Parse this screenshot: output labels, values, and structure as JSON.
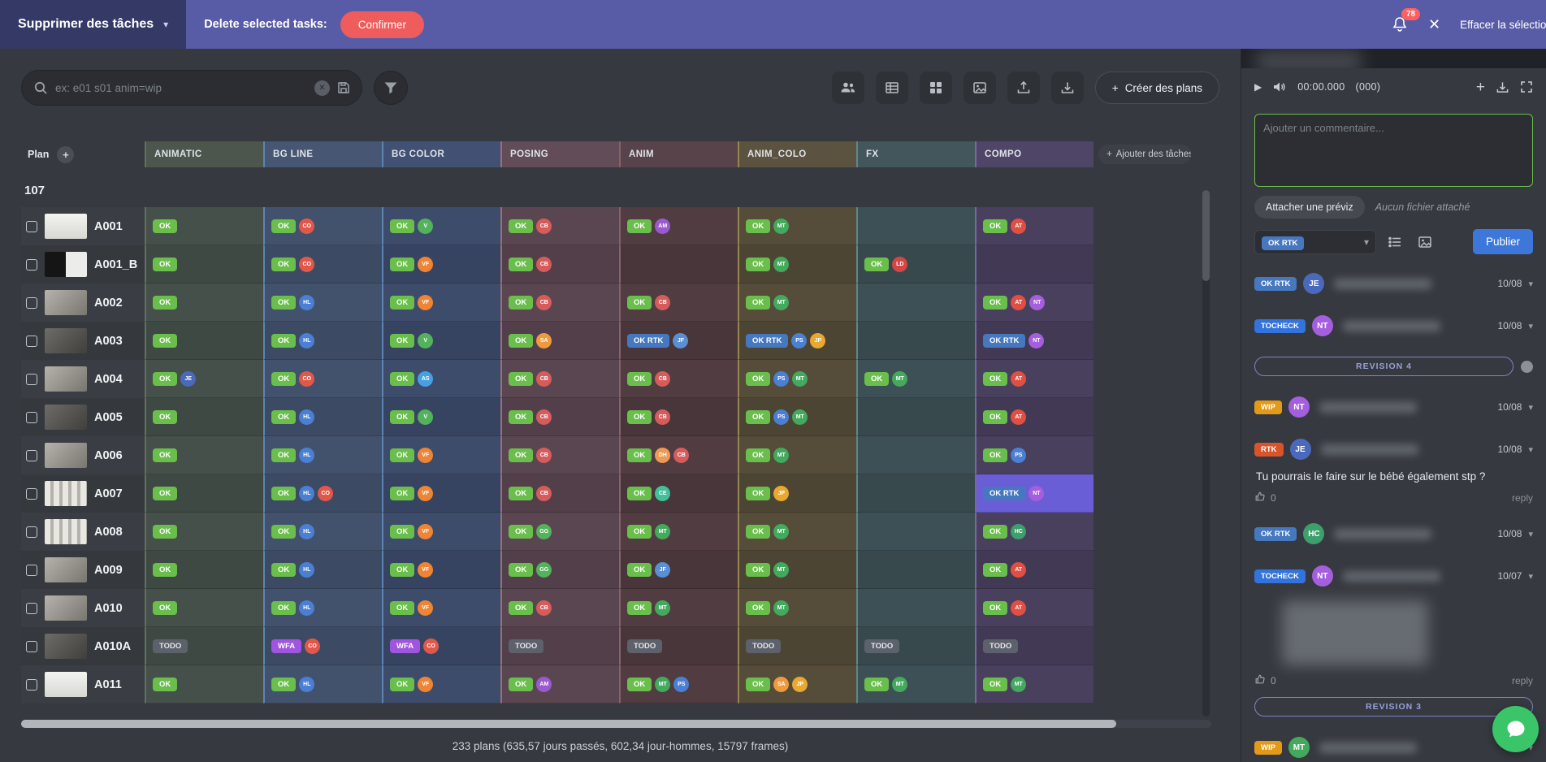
{
  "icons": {
    "chevron_down": "▾",
    "close": "✕",
    "plus": "+",
    "play": "▶"
  },
  "colors": {
    "selection": "#6a5ed6",
    "accent_green": "#6abe4b",
    "publish_blue": "#3d77d9",
    "topbar_purple": "#585ca6",
    "confirm_red": "#ee5c5c"
  },
  "topbar": {
    "selector_label": "Supprimer des tâches",
    "action_label": "Delete selected tasks:",
    "confirm_label": "Confirmer",
    "notification_count": "78",
    "clear_selection_label": "Effacer la sélection"
  },
  "toolbar": {
    "search_placeholder": "ex: e01 s01 anim=wip",
    "create_button_label": "Créer des plans"
  },
  "table": {
    "count": "107",
    "plan_header": "Plan",
    "add_tasks_label": "Ajouter des tâches",
    "columns": [
      {
        "key": "animatic",
        "label": "ANIMATIC",
        "hbg": "#4c564d",
        "cbg": "#46504a",
        "cbg2": "#3f4943",
        "bord": "#61705f"
      },
      {
        "key": "bgline",
        "label": "BG LINE",
        "hbg": "#475773",
        "cbg": "#43526c",
        "cbg2": "#3c4b63",
        "bord": "#5d83b4"
      },
      {
        "key": "bgcolor",
        "label": "BG COLOR",
        "hbg": "#425073",
        "cbg": "#3e4c6b",
        "cbg2": "#374461",
        "bord": "#5d83b4"
      },
      {
        "key": "posing",
        "label": "POSING",
        "hbg": "#614c58",
        "cbg": "#5a4650",
        "cbg2": "#523f49",
        "bord": "#96707f"
      },
      {
        "key": "anim",
        "label": "ANIM",
        "hbg": "#574349",
        "cbg": "#503c41",
        "cbg2": "#48363b",
        "bord": "#8a616a"
      },
      {
        "key": "anim_colo",
        "label": "ANIM_COLO",
        "hbg": "#5b5340",
        "cbg": "#554c3a",
        "cbg2": "#4d4534",
        "bord": "#95854f"
      },
      {
        "key": "fx",
        "label": "FX",
        "hbg": "#43565b",
        "cbg": "#3d5055",
        "cbg2": "#37494d",
        "bord": "#5f868c"
      },
      {
        "key": "compo",
        "label": "COMPO",
        "hbg": "#4f4566",
        "cbg": "#49405e",
        "cbg2": "#423a55",
        "bord": "#7a66a5"
      }
    ],
    "rows": [
      {
        "name": "A001",
        "thumb": "light",
        "cells": [
          {
            "s": "OK"
          },
          {
            "s": "OK",
            "a": [
              "CO"
            ]
          },
          {
            "s": "OK",
            "a": [
              "V"
            ]
          },
          {
            "s": "OK",
            "a": [
              "CB"
            ]
          },
          {
            "s": "OK",
            "a": [
              "AM"
            ]
          },
          {
            "s": "OK",
            "a": [
              "MT"
            ]
          },
          null,
          {
            "s": "OK",
            "a": [
              "AT"
            ]
          }
        ]
      },
      {
        "name": "A001_B",
        "thumb": "split",
        "cells": [
          {
            "s": "OK"
          },
          {
            "s": "OK",
            "a": [
              "CO"
            ]
          },
          {
            "s": "OK",
            "a": [
              "VF"
            ]
          },
          {
            "s": "OK",
            "a": [
              "CB"
            ]
          },
          null,
          {
            "s": "OK",
            "a": [
              "MT"
            ]
          },
          {
            "s": "OK",
            "a": [
              "LD"
            ]
          },
          null
        ]
      },
      {
        "name": "A002",
        "thumb": "mid",
        "cells": [
          {
            "s": "OK"
          },
          {
            "s": "OK",
            "a": [
              "HL"
            ]
          },
          {
            "s": "OK",
            "a": [
              "VF"
            ]
          },
          {
            "s": "OK",
            "a": [
              "CB"
            ]
          },
          {
            "s": "OK",
            "a": [
              "CB"
            ]
          },
          {
            "s": "OK",
            "a": [
              "MT"
            ]
          },
          null,
          {
            "s": "OK",
            "a": [
              "AT",
              "NT"
            ]
          }
        ]
      },
      {
        "name": "A003",
        "thumb": "dark",
        "cells": [
          {
            "s": "OK"
          },
          {
            "s": "OK",
            "a": [
              "HL"
            ]
          },
          {
            "s": "OK",
            "a": [
              "V"
            ]
          },
          {
            "s": "OK",
            "a": [
              "SA"
            ]
          },
          {
            "s": "OK RTK",
            "a": [
              "JF"
            ]
          },
          {
            "s": "OK RTK",
            "a": [
              "PS",
              "JP"
            ]
          },
          null,
          {
            "s": "OK RTK",
            "a": [
              "NT"
            ]
          }
        ]
      },
      {
        "name": "A004",
        "thumb": "mid",
        "cells": [
          {
            "s": "OK",
            "a": [
              "JE"
            ]
          },
          {
            "s": "OK",
            "a": [
              "CO"
            ]
          },
          {
            "s": "OK",
            "a": [
              "AS"
            ]
          },
          {
            "s": "OK",
            "a": [
              "CB"
            ]
          },
          {
            "s": "OK",
            "a": [
              "CB"
            ]
          },
          {
            "s": "OK",
            "a": [
              "PS",
              "MT"
            ]
          },
          {
            "s": "OK",
            "a": [
              "MT"
            ]
          },
          {
            "s": "OK",
            "a": [
              "AT"
            ]
          }
        ]
      },
      {
        "name": "A005",
        "thumb": "dark",
        "cells": [
          {
            "s": "OK"
          },
          {
            "s": "OK",
            "a": [
              "HL"
            ]
          },
          {
            "s": "OK",
            "a": [
              "V"
            ]
          },
          {
            "s": "OK",
            "a": [
              "CB"
            ]
          },
          {
            "s": "OK",
            "a": [
              "CB"
            ]
          },
          {
            "s": "OK",
            "a": [
              "PS",
              "MT"
            ]
          },
          null,
          {
            "s": "OK",
            "a": [
              "AT"
            ]
          }
        ]
      },
      {
        "name": "A006",
        "thumb": "mid",
        "cells": [
          {
            "s": "OK"
          },
          {
            "s": "OK",
            "a": [
              "HL"
            ]
          },
          {
            "s": "OK",
            "a": [
              "VF"
            ]
          },
          {
            "s": "OK",
            "a": [
              "CB"
            ]
          },
          {
            "s": "OK",
            "a": [
              "DH",
              "CB"
            ]
          },
          {
            "s": "OK",
            "a": [
              "MT"
            ]
          },
          null,
          {
            "s": "OK",
            "a": [
              "PS"
            ]
          }
        ]
      },
      {
        "name": "A007",
        "thumb": "stripes",
        "cells": [
          {
            "s": "OK"
          },
          {
            "s": "OK",
            "a": [
              "HL",
              "CO"
            ]
          },
          {
            "s": "OK",
            "a": [
              "VF"
            ]
          },
          {
            "s": "OK",
            "a": [
              "CB"
            ]
          },
          {
            "s": "OK",
            "a": [
              "CE"
            ]
          },
          {
            "s": "OK",
            "a": [
              "JP"
            ]
          },
          null,
          {
            "s": "OK RTK",
            "a": [
              "NT"
            ],
            "sel": true
          }
        ]
      },
      {
        "name": "A008",
        "thumb": "stripes",
        "cells": [
          {
            "s": "OK"
          },
          {
            "s": "OK",
            "a": [
              "HL"
            ]
          },
          {
            "s": "OK",
            "a": [
              "VF"
            ]
          },
          {
            "s": "OK",
            "a": [
              "GG"
            ]
          },
          {
            "s": "OK",
            "a": [
              "MT"
            ]
          },
          {
            "s": "OK",
            "a": [
              "MT"
            ]
          },
          null,
          {
            "s": "OK",
            "a": [
              "HC"
            ]
          }
        ]
      },
      {
        "name": "A009",
        "thumb": "mid",
        "cells": [
          {
            "s": "OK"
          },
          {
            "s": "OK",
            "a": [
              "HL"
            ]
          },
          {
            "s": "OK",
            "a": [
              "VF"
            ]
          },
          {
            "s": "OK",
            "a": [
              "GG"
            ]
          },
          {
            "s": "OK",
            "a": [
              "JF"
            ]
          },
          {
            "s": "OK",
            "a": [
              "MT"
            ]
          },
          null,
          {
            "s": "OK",
            "a": [
              "AT"
            ]
          }
        ]
      },
      {
        "name": "A010",
        "thumb": "mid",
        "cells": [
          {
            "s": "OK"
          },
          {
            "s": "OK",
            "a": [
              "HL"
            ]
          },
          {
            "s": "OK",
            "a": [
              "VF"
            ]
          },
          {
            "s": "OK",
            "a": [
              "CB"
            ]
          },
          {
            "s": "OK",
            "a": [
              "MT"
            ]
          },
          {
            "s": "OK",
            "a": [
              "MT"
            ]
          },
          null,
          {
            "s": "OK",
            "a": [
              "AT"
            ]
          }
        ]
      },
      {
        "name": "A010A",
        "thumb": "dark",
        "cells": [
          {
            "s": "TODO"
          },
          {
            "s": "WFA",
            "a": [
              "CO"
            ]
          },
          {
            "s": "WFA",
            "a": [
              "CO"
            ]
          },
          {
            "s": "TODO"
          },
          {
            "s": "TODO"
          },
          {
            "s": "TODO"
          },
          {
            "s": "TODO"
          },
          {
            "s": "TODO"
          }
        ]
      },
      {
        "name": "A011",
        "thumb": "light",
        "cells": [
          {
            "s": "OK"
          },
          {
            "s": "OK",
            "a": [
              "HL"
            ]
          },
          {
            "s": "OK",
            "a": [
              "VF"
            ]
          },
          {
            "s": "OK",
            "a": [
              "AM"
            ]
          },
          {
            "s": "OK",
            "a": [
              "MT",
              "PS"
            ]
          },
          {
            "s": "OK",
            "a": [
              "SA",
              "JP"
            ]
          },
          {
            "s": "OK",
            "a": [
              "MT"
            ]
          },
          {
            "s": "OK",
            "a": [
              "MT"
            ]
          }
        ]
      }
    ]
  },
  "footer": {
    "summary": "233 plans (635,57 jours passés, 602,34 jour-hommes, 15797 frames)"
  },
  "panel": {
    "player": {
      "time": "00:00.000",
      "frame": "(000)"
    },
    "comment_placeholder": "Ajouter un commentaire...",
    "attach_label": "Attacher une préviz",
    "no_file_label": "Aucun fichier attaché",
    "status_value": "OK RTK",
    "publish_label": "Publier",
    "comments": [
      {
        "type": "comment",
        "status": "OK RTK",
        "avatar": "JE",
        "date": "10/08"
      },
      {
        "type": "comment",
        "status": "TOCHECK",
        "avatar": "NT",
        "date": "10/08"
      },
      {
        "type": "revision",
        "label": "REVISION 4",
        "has_dot": true
      },
      {
        "type": "comment",
        "status": "WIP",
        "avatar": "NT",
        "date": "10/08"
      },
      {
        "type": "comment",
        "status": "RTK",
        "avatar": "JE",
        "date": "10/08",
        "text": "Tu pourrais le faire sur le bébé également stp ?",
        "likes": "0",
        "reply": "reply"
      },
      {
        "type": "comment",
        "status": "OK RTK",
        "avatar": "HC",
        "date": "10/08"
      },
      {
        "type": "comment",
        "status": "TOCHECK",
        "avatar": "NT",
        "date": "10/07",
        "image": true,
        "likes": "0",
        "reply": "reply"
      },
      {
        "type": "revision",
        "label": "REVISION 3"
      },
      {
        "type": "comment",
        "status": "WIP",
        "avatar": "MT",
        "date": "",
        "partial": true
      }
    ]
  },
  "statuses": {
    "OK": {
      "label": "OK",
      "bg": "#6abe4b",
      "fg": "#ffffff"
    },
    "OK RTK": {
      "label": "OK RTK",
      "bg": "#4678c0",
      "fg": "#ffffff"
    },
    "TOCHECK": {
      "label": "TOCHECK",
      "bg": "#3273dc",
      "fg": "#ffffff"
    },
    "TODO": {
      "label": "TODO",
      "bg": "#5d616b",
      "fg": "#e4e7ec"
    },
    "WFA": {
      "label": "WFA",
      "bg": "#9f55e0",
      "fg": "#ffffff"
    },
    "WIP": {
      "label": "WIP",
      "bg": "#e39a18",
      "fg": "#ffffff"
    },
    "RTK": {
      "label": "RTK",
      "bg": "#d9532b",
      "fg": "#ffffff"
    }
  },
  "avatars": {
    "CO": "#e1584b",
    "HL": "#4a7fd4",
    "VF": "#ee8434",
    "V": "#53b25c",
    "CB": "#d65c5c",
    "AM": "#9b59d0",
    "MT": "#43a95c",
    "AT": "#e04f44",
    "NT": "#a55ede",
    "JE": "#4a69bd",
    "AS": "#45a0e6",
    "PS": "#4a7fd4",
    "JP": "#e8a832",
    "SA": "#f09a3e",
    "DH": "#ee9a55",
    "GG": "#53b25c",
    "JF": "#5a8fd4",
    "CE": "#43bf9a",
    "LD": "#d64545",
    "HC": "#3da06c"
  }
}
